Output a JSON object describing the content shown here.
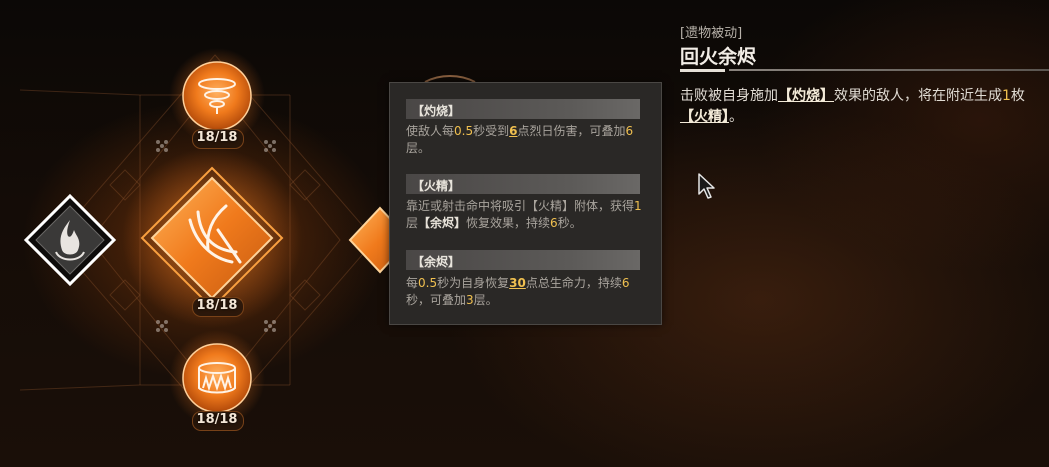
{
  "skill_tree": {
    "nodes": [
      {
        "id": "top",
        "name": "tornado-fire-skill",
        "count": "18/18"
      },
      {
        "id": "center",
        "name": "flame-slash-skill",
        "count": "18/18"
      },
      {
        "id": "bottom",
        "name": "fire-ring-skill",
        "count": "18/18"
      },
      {
        "id": "left",
        "name": "fire-emblem-skill",
        "count": ""
      }
    ]
  },
  "tooltip": {
    "sections": [
      {
        "title": "【灼烧】",
        "text": [
          "使敌人每",
          "0.5",
          "秒受到",
          "6",
          "点烈日伤害，可叠加",
          "6",
          "层。"
        ]
      },
      {
        "title": "【火精】",
        "text": [
          "靠近或射击命中将吸引【火精】附体，获得",
          "1",
          "层",
          "【余烬】",
          "恢复效果，持续",
          "6",
          "秒。"
        ]
      },
      {
        "title": "【余烬】",
        "text": [
          "每",
          "0.5",
          "秒为自身恢复",
          "30",
          "点总生命力，持续",
          "6",
          "秒，可叠加",
          "3",
          "层。"
        ]
      }
    ]
  },
  "relic": {
    "tag": "[遗物被动]",
    "title": "回火余烬",
    "desc": [
      "击败被自身施加",
      "【灼烧】",
      "效果的敌人，将在附近生成",
      "1",
      "枚",
      "【火精】",
      "。"
    ]
  },
  "colors": {
    "highlight": "#f0c050",
    "orange": "#f08a28",
    "panel": "#2a2826"
  }
}
